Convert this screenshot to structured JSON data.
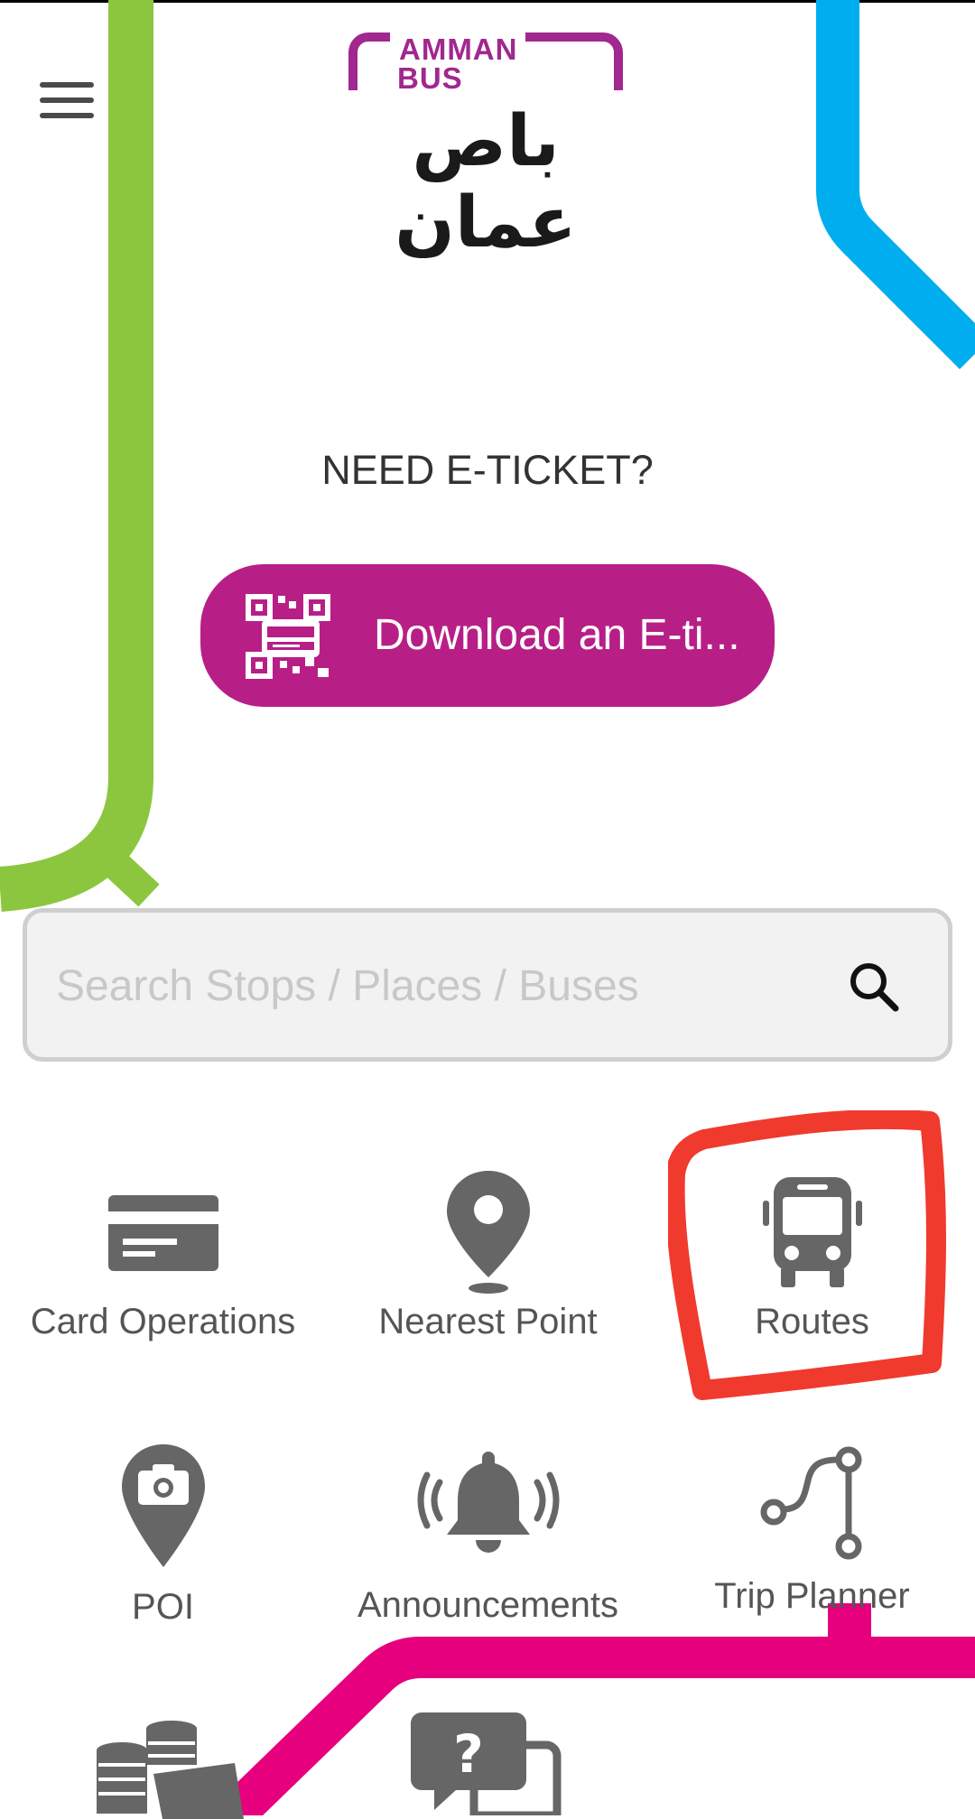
{
  "header": {
    "menu_icon": "hamburger-menu-icon",
    "logo": {
      "text_en_line1": "AMMAN",
      "text_en_line2": "BUS",
      "text_ar": "باص عمان",
      "brand_color": "#a0288f"
    }
  },
  "eticket": {
    "prompt": "NEED E-TICKET?",
    "download_label": "Download an E-ti...",
    "download_icon": "qr-ticket-icon",
    "button_color": "#b71f86"
  },
  "search": {
    "placeholder": "Search Stops / Places / Buses",
    "value": "",
    "icon": "search-icon"
  },
  "menu_grid": [
    {
      "label": "Card Operations",
      "icon": "card-icon"
    },
    {
      "label": "Nearest Point",
      "icon": "location-pin-icon"
    },
    {
      "label": "Routes",
      "icon": "bus-icon",
      "highlighted": true
    },
    {
      "label": "POI",
      "icon": "camera-pin-icon"
    },
    {
      "label": "Announcements",
      "icon": "bell-icon"
    },
    {
      "label": "Trip Planner",
      "icon": "route-path-icon"
    },
    {
      "label": "",
      "icon": "money-icon"
    },
    {
      "label": "",
      "icon": "faq-chat-icon"
    }
  ],
  "colors": {
    "line_green": "#8cc63f",
    "line_blue": "#00aeef",
    "line_magenta": "#e6007e",
    "highlight_red": "#f03a2e",
    "icon_gray": "#666666"
  }
}
